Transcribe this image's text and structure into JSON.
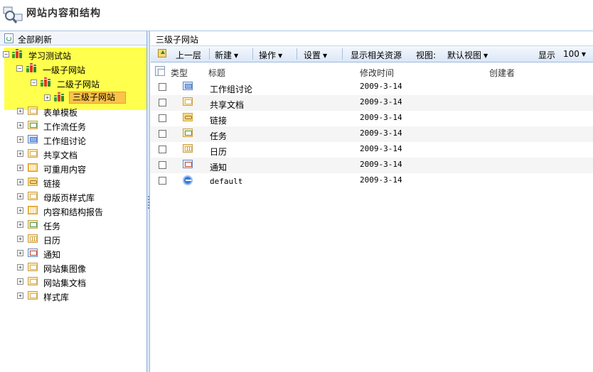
{
  "header": {
    "title": "网站内容和结构"
  },
  "tree": {
    "refresh_label": "全部刷新",
    "root": "学习测试站",
    "level1": "一级子网站",
    "level2": "二级子网站",
    "level3": "三级子网站",
    "libraries": [
      {
        "label": "表单模板",
        "icon": "folder-icon"
      },
      {
        "label": "工作流任务",
        "icon": "task-list-icon"
      },
      {
        "label": "工作组讨论",
        "icon": "discussion-icon"
      },
      {
        "label": "共享文档",
        "icon": "document-library-icon"
      },
      {
        "label": "可重用内容",
        "icon": "list-grid-icon"
      },
      {
        "label": "链接",
        "icon": "link-list-icon"
      },
      {
        "label": "母版页样式库",
        "icon": "document-library-icon"
      },
      {
        "label": "内容和结构报告",
        "icon": "list-grid-icon"
      },
      {
        "label": "任务",
        "icon": "task-list-icon"
      },
      {
        "label": "日历",
        "icon": "calendar-icon"
      },
      {
        "label": "通知",
        "icon": "announcement-icon"
      },
      {
        "label": "网站集图像",
        "icon": "document-library-icon"
      },
      {
        "label": "网站集文档",
        "icon": "document-library-icon"
      },
      {
        "label": "样式库",
        "icon": "document-library-icon"
      }
    ]
  },
  "breadcrumb": "三级子网站",
  "toolbar": {
    "up": "上一层",
    "new": "新建",
    "actions": "操作",
    "settings": "设置",
    "show_related": "显示相关资源",
    "view_label": "视图:",
    "view_value": "默认视图",
    "show_label": "显示",
    "show_value": "100"
  },
  "columns": {
    "type": "类型",
    "title": "标题",
    "modified": "修改时间",
    "creator": "创建者"
  },
  "rows": [
    {
      "title": "工作组讨论",
      "modified": "2009-3-14",
      "icon": "discussion-icon"
    },
    {
      "title": "共享文档",
      "modified": "2009-3-14",
      "icon": "document-library-icon"
    },
    {
      "title": "链接",
      "modified": "2009-3-14",
      "icon": "link-list-icon"
    },
    {
      "title": "任务",
      "modified": "2009-3-14",
      "icon": "task-list-icon"
    },
    {
      "title": "日历",
      "modified": "2009-3-14",
      "icon": "calendar-icon"
    },
    {
      "title": "通知",
      "modified": "2009-3-14",
      "icon": "announcement-icon"
    },
    {
      "title": "default",
      "modified": "2009-3-14",
      "icon": "web-page-icon"
    }
  ],
  "colors": {
    "highlight": "#ffff4d",
    "selected": "#fbc34a",
    "toolbar": "#dbe7f7"
  }
}
